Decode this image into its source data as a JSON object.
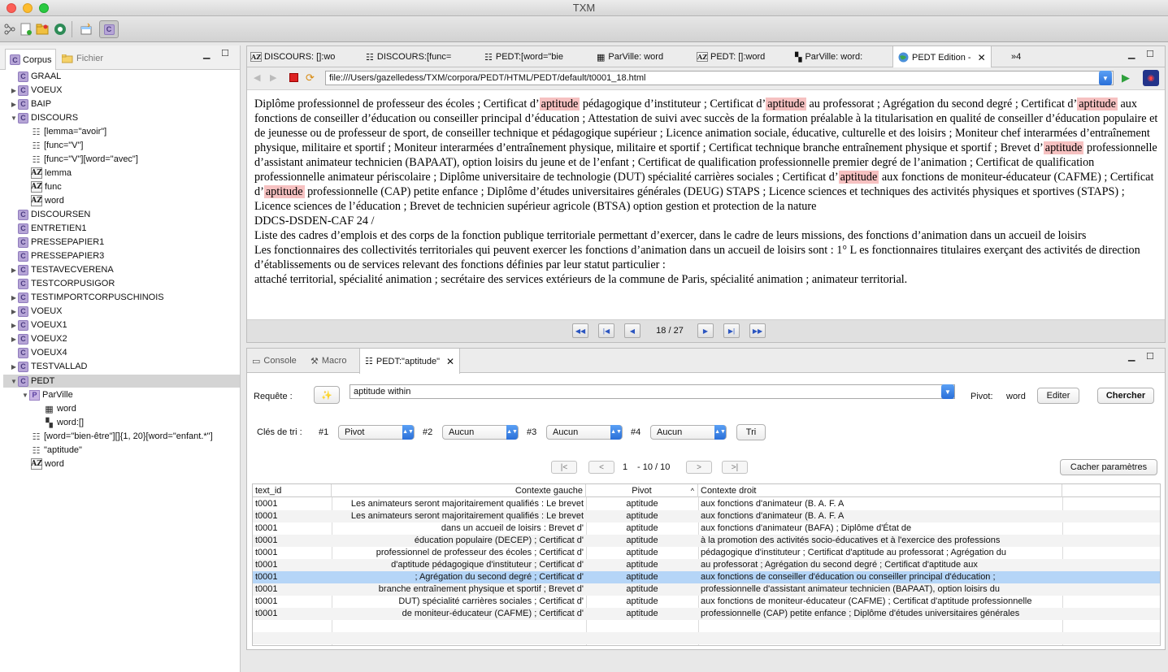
{
  "window": {
    "title": "TXM"
  },
  "left_panel": {
    "tabs": [
      {
        "label": "Corpus"
      },
      {
        "label": "Fichier"
      }
    ],
    "tree": [
      {
        "label": "GRAAL"
      },
      {
        "label": "VOEUX"
      },
      {
        "label": "BAIP"
      },
      {
        "label": "DISCOURS"
      },
      {
        "label": "[lemma=\"avoir\"]"
      },
      {
        "label": "[func=\"V\"]"
      },
      {
        "label": "[func=\"V\"][word=\"avec\"]"
      },
      {
        "label": "lemma"
      },
      {
        "label": "func"
      },
      {
        "label": "word"
      },
      {
        "label": "DISCOURSEN"
      },
      {
        "label": "ENTRETIEN1"
      },
      {
        "label": "PRESSEPAPIER1"
      },
      {
        "label": "PRESSEPAPIER3"
      },
      {
        "label": "TESTAVECVERENA"
      },
      {
        "label": "TESTCORPUSIGOR"
      },
      {
        "label": "TESTIMPORTCORPUSCHINOIS"
      },
      {
        "label": "VOEUX"
      },
      {
        "label": "VOEUX1"
      },
      {
        "label": "VOEUX2"
      },
      {
        "label": "VOEUX4"
      },
      {
        "label": "TESTVALLAD"
      },
      {
        "label": "PEDT"
      },
      {
        "label": "ParVille"
      },
      {
        "label": "word"
      },
      {
        "label": "word:[]"
      },
      {
        "label": "[word=\"bien-être\"][]{1, 20}[word=\"enfant.*\"]"
      },
      {
        "label": "\"aptitude\""
      },
      {
        "label": "word"
      }
    ]
  },
  "editor": {
    "tabs": [
      {
        "label": "DISCOURS: []:wo"
      },
      {
        "label": "DISCOURS:[func="
      },
      {
        "label": "PEDT:[word=\"bie"
      },
      {
        "label": "ParVille: word"
      },
      {
        "label": "PEDT: []:word"
      },
      {
        "label": "ParVille: word:"
      },
      {
        "label": "PEDT Edition -"
      }
    ],
    "overflow_label": "»4",
    "url": "file:///Users/gazelledess/TXM/corpora/PEDT/HTML/PEDT/default/t0001_18.html",
    "highlight_word": "aptitude",
    "para1_s1": "Diplôme professionnel de professeur des écoles ; Certificat d’",
    "para1_s2": " pédagogique d’instituteur ; Certificat d’",
    "para1_s3": " au professorat ; Agrégation du second degré ; Certificat d’",
    "para1_s4": " aux fonctions de conseiller d’éducation ou conseiller principal d’éducation ; Attestation de suivi avec succès de la formation préalable à la titularisation en qualité de conseiller d’éducation populaire et de jeunesse ou de professeur de sport, de conseiller technique et pédagogique supérieur ; Licence animation sociale, éducative, culturelle et des loisirs ; Moniteur chef interarmées d’entraînement physique, militaire et sportif ; Moniteur interarmées d’entraînement physique, militaire et sportif ; Certificat technique branche entraînement physique et sportif ; Brevet d’",
    "para1_s5": " professionnelle d’assistant animateur technicien (BAPAAT), option loisirs du jeune et de l’enfant ; Certificat de qualification professionnelle premier degré de l’animation ; Certificat de qualification professionnelle animateur périscolaire ; Diplôme universitaire de technologie (DUT) spécialité carrières sociales ; Certificat d’",
    "para1_s6": " aux fonctions de moniteur-éducateur (CAFME) ; Certificat d’",
    "para1_s7": " professionnelle (CAP) petite enfance ; Diplôme d’études universitaires générales (DEUG) STAPS ; Licence sciences et techniques des activités physiques et sportives (STAPS) ; Licence sciences de l’éducation ; Brevet de technicien supérieur agricole (BTSA) option gestion et protection de la nature",
    "para2": "DDCS-DSDEN-CAF 24 /",
    "para3": "Liste des cadres d’emplois et des corps de la fonction publique territoriale permettant d’exercer, dans le cadre de leurs missions, des fonctions d’animation dans un accueil de loisirs",
    "para4": "Les fonctionnaires des collectivités territoriales qui peuvent exercer les fonctions d’animation dans un accueil de loisirs sont : 1° L es fonctionnaires titulaires exerçant des activités de direction d’établissements ou de services relevant des fonctions définies par leur statut particulier :",
    "para5": "attaché territorial, spécialité animation ; secrétaire des services extérieurs de la commune de Paris, spécialité animation ; animateur territorial.",
    "page_indicator": "18 / 27"
  },
  "bottom_panel": {
    "tabs": [
      {
        "label": "Console"
      },
      {
        "label": "Macro"
      },
      {
        "label": "PEDT:\"aptitude\""
      }
    ],
    "query_label": "Requête :",
    "query_value": "aptitude within",
    "pivot_label": "Pivot:",
    "pivot_value": "word",
    "edit_button": "Editer",
    "search_button": "Chercher",
    "sort_label": "Clés de tri :",
    "sort_keys": [
      {
        "label": "#1",
        "value": "Pivot"
      },
      {
        "label": "#2",
        "value": "Aucun"
      },
      {
        "label": "#3",
        "value": "Aucun"
      },
      {
        "label": "#4",
        "value": "Aucun"
      }
    ],
    "sort_button": "Tri",
    "pagination": {
      "first": "|<",
      "prev": "<",
      "current": "1",
      "of": "- 10 / 10",
      "next": ">",
      "last": ">|"
    },
    "hide_params_button": "Cacher paramètres",
    "columns": {
      "text_id": "text_id",
      "left": "Contexte gauche",
      "pivot": "Pivot",
      "right": "Contexte droit"
    },
    "rows": [
      {
        "text_id": "t0001",
        "left": "Les animateurs seront majoritairement qualifiés : Le brevet",
        "pivot": "aptitude",
        "right": "aux fonctions d'animateur (B. A. F. A"
      },
      {
        "text_id": "t0001",
        "left": "Les animateurs seront majoritairement qualifiés : Le brevet",
        "pivot": "aptitude",
        "right": "aux fonctions d'animateur (B. A. F. A"
      },
      {
        "text_id": "t0001",
        "left": "dans un accueil de loisirs : Brevet d'",
        "pivot": "aptitude",
        "right": "aux fonctions d'animateur (BAFA) ; Diplôme d'État de"
      },
      {
        "text_id": "t0001",
        "left": "éducation populaire (DECEP) ; Certificat d'",
        "pivot": "aptitude",
        "right": "à la promotion des activités socio-éducatives et à l'exercice des professions"
      },
      {
        "text_id": "t0001",
        "left": "professionnel de professeur des écoles ; Certificat d'",
        "pivot": "aptitude",
        "right": "pédagogique d'instituteur ; Certificat d'aptitude au professorat ; Agrégation du"
      },
      {
        "text_id": "t0001",
        "left": "d'aptitude pédagogique d'instituteur ; Certificat d'",
        "pivot": "aptitude",
        "right": "au professorat ; Agrégation du second degré ; Certificat d'aptitude aux"
      },
      {
        "text_id": "t0001",
        "left": "; Agrégation du second degré ; Certificat d'",
        "pivot": "aptitude",
        "right": "aux fonctions de conseiller d'éducation ou conseiller principal d'éducation ;"
      },
      {
        "text_id": "t0001",
        "left": "branche entraînement physique et sportif ; Brevet d'",
        "pivot": "aptitude",
        "right": "professionnelle d'assistant animateur technicien (BAPAAT), option loisirs du"
      },
      {
        "text_id": "t0001",
        "left": "DUT) spécialité carrières sociales ; Certificat d'",
        "pivot": "aptitude",
        "right": "aux fonctions de moniteur-éducateur (CAFME) ; Certificat d'aptitude professionnelle"
      },
      {
        "text_id": "t0001",
        "left": "de moniteur-éducateur (CAFME) ; Certificat d'",
        "pivot": "aptitude",
        "right": "professionnelle (CAP) petite enfance ; Diplôme d'études universitaires générales"
      }
    ],
    "selected_row": 6
  },
  "colors": {
    "highlight": "#f6c1c1",
    "selection": "#b5d5f7",
    "accent": "#2a6fd8"
  }
}
